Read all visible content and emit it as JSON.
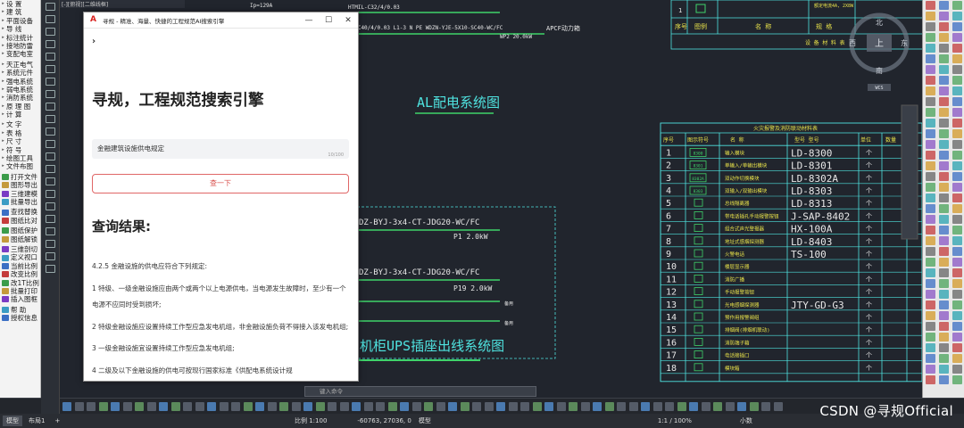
{
  "left_palette": {
    "items": [
      "设 置",
      "建 筑",
      "平面设备",
      "导 线",
      "标注统计",
      "接地防雷",
      "变配电室",
      "天正电气",
      "系统元件",
      "强电系统",
      "弱电系统",
      "消防系统",
      "原 理 图",
      "计 算",
      "文 字",
      "表 格",
      "尺 寸",
      "符 号",
      "绘图工具",
      "文件布图",
      "打开文件",
      "图形导出",
      "三维建模",
      "批量导出",
      "查找替换",
      "图纸比对",
      "图纸保护",
      "图纸解锁",
      "三维剖切",
      "定义视口",
      "当前比例",
      "改变比例",
      "改1T比例",
      "批量打印",
      "插入图框",
      "帮 助",
      "授权信息"
    ]
  },
  "canvas": {
    "viewport_tab": "[-][俯视][二维线框]",
    "top_text_1": "Ip=129A",
    "top_text_2": "HTMIL-C32/4/0.03",
    "top_text_3": "L1-C40/4/0.03 L1-3 N PE WDZN-YJE-5X10-SC40-WC/FC",
    "top_text_4": "APCF动力箱",
    "top_text_5": "WP2 20.0kW",
    "al_title": "AL配电系统图",
    "circuit_1": "DZ-BYJ-3x4-CT-JDG20-WC/FC",
    "circuit_1_p": "P1  2.0kW",
    "circuit_2": "DZ-BYJ-3x4-CT-JDG20-WC/FC",
    "circuit_2_p": "P19 2.0kW",
    "circuit_spare": "备用",
    "ups_title": "机柜UPS插座出线系统图",
    "legend_header_top": [
      "序号",
      "图例",
      "名    称",
      "规    格"
    ],
    "legend_header_top_2": "设 备 材 料 表",
    "legend_top_row": "1",
    "legend_top_spec": "额定电流4A, 2X8W",
    "table_title": "火灾报警及消防联动材料表",
    "table_headers": [
      "序号",
      "图示符号",
      "名    称",
      "型号  型号",
      "单位",
      "数量"
    ],
    "table_rows": [
      {
        "no": "1",
        "sym": "8300",
        "name": "输入模块",
        "model": "LD-8300",
        "unit": "个"
      },
      {
        "no": "2",
        "sym": "8301",
        "name": "单输入/单输出模块",
        "model": "LD-8301",
        "unit": "个"
      },
      {
        "no": "3",
        "sym": "8302A",
        "name": "双动作切换模块",
        "model": "LD-8302A",
        "unit": "个"
      },
      {
        "no": "4",
        "sym": "8303",
        "name": "双输入/双输出模块",
        "model": "LD-8303",
        "unit": "个"
      },
      {
        "no": "5",
        "sym": "",
        "name": "总线隔离器",
        "model": "LD-8313",
        "unit": "个"
      },
      {
        "no": "6",
        "sym": "",
        "name": "带电话插孔手动报警按钮",
        "model": "J-SAP-8402",
        "unit": "个"
      },
      {
        "no": "7",
        "sym": "",
        "name": "组合式声光警报器",
        "model": "HX-100A",
        "unit": "个"
      },
      {
        "no": "8",
        "sym": "",
        "name": "地址式感烟探测器",
        "model": "LD-8403",
        "unit": "个"
      },
      {
        "no": "9",
        "sym": "",
        "name": "火警电话",
        "model": "TS-100",
        "unit": "个"
      },
      {
        "no": "10",
        "sym": "",
        "name": "楼层显示器",
        "model": "",
        "unit": "个"
      },
      {
        "no": "11",
        "sym": "",
        "name": "消防广播",
        "model": "",
        "unit": "个"
      },
      {
        "no": "12",
        "sym": "",
        "name": "手动报警按钮",
        "model": "",
        "unit": "个"
      },
      {
        "no": "13",
        "sym": "",
        "name": "光电感烟探测器",
        "model": "JTY-GD-G3",
        "unit": "个"
      },
      {
        "no": "14",
        "sym": "",
        "name": "预作用报警阀组",
        "model": "",
        "unit": "个"
      },
      {
        "no": "15",
        "sym": "",
        "name": "排烟阀(排烟机联动)",
        "model": "",
        "unit": "个"
      },
      {
        "no": "16",
        "sym": "",
        "name": "消防端子箱",
        "model": "",
        "unit": "个"
      },
      {
        "no": "17",
        "sym": "",
        "name": "电话接插口",
        "model": "",
        "unit": "个"
      },
      {
        "no": "18",
        "sym": "",
        "name": "模块箱",
        "model": "",
        "unit": "个"
      }
    ],
    "compass": {
      "north": "北",
      "south": "南",
      "east": "东",
      "west": "西",
      "center": "上",
      "wcs": "WCS"
    }
  },
  "dialog": {
    "title": "寻规 - 精准、海量、快捷的工程规范AI搜索引擎",
    "back_icon": "›",
    "heading": "寻规，工程规范搜索引擎",
    "search_value": "金融建筑设施供电规定",
    "counter": "10/100",
    "search_button": "查一下",
    "results_heading": "查询结果:",
    "results": [
      "4.2.5   金融设施的供电应符合下列规定:",
      "1   特级、一级金融设施应由两个或两个以上电源供电，当电源发生故障时，至少有一个电源不应同时受到损坏;",
      "2   特级金融设施应设置持续工作型应急发电机组，非金融设施负荷不得接入该发电机组;",
      "3   一级金融设施宜设置持续工作型应急发电机组;",
      "4   二级及以下金融设施的供电可按现行国家标准《供配电系统设计规"
    ]
  },
  "cmdline": {
    "placeholder": "键入命令"
  },
  "status": {
    "layout_tabs": [
      "模型",
      "布局1",
      "+"
    ],
    "scale": "比例 1:100",
    "coords": "-60763, 27036, 0",
    "mode": "模型",
    "zoom": "1:1 / 100%",
    "units": "小数",
    "watermark": "CSDN @寻规Official"
  },
  "colors": {
    "canvas_bg": "#21252d",
    "cad_cyan": "#4fe3e0",
    "cad_green": "#3fd36a",
    "cad_white": "#e8e8e8",
    "cad_yellow": "#e8e24a",
    "button_red": "#d9534f"
  }
}
